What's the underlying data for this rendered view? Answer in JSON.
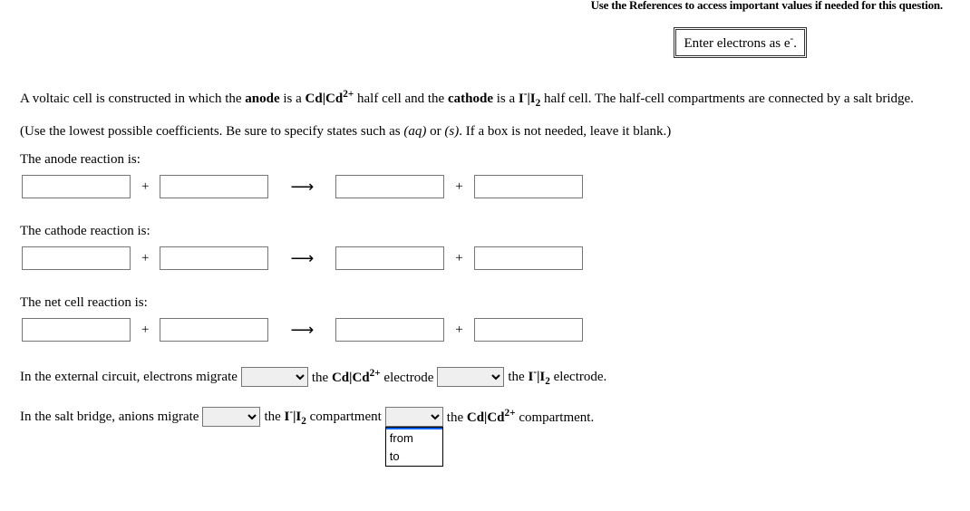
{
  "top_cutoff": "Use the References to access important values if needed for this question.",
  "hint_prefix": "Enter electrons as e",
  "hint_sup": "-",
  "hint_suffix": ".",
  "q_p1": "A voltaic cell is constructed in which the ",
  "q_b1": "anode",
  "q_p2": " is a ",
  "q_cd_a": "Cd",
  "q_cd_b": "|Cd",
  "q_cd_sup": "2+",
  "q_p3": " half cell and the ",
  "q_b2": "cathode",
  "q_p4": " is a ",
  "q_i_a": "I",
  "q_i_sup": "-",
  "q_i_b": "|I",
  "q_i_sub": "2",
  "q_p5": " half cell. The half-cell compartments are connected by a salt bridge.",
  "instr_a": "(Use the lowest possible coefficients. Be sure to specify states such as ",
  "instr_i1": "(aq)",
  "instr_b": " or ",
  "instr_i2": "(s)",
  "instr_c": ". If a box is not needed, leave it blank.)",
  "sec_anode": "The anode reaction is:",
  "sec_cathode": "The cathode reaction is:",
  "sec_net": "The net cell reaction is:",
  "plus": "+",
  "arrow": "⟶",
  "mig1_a": "In the external circuit, electrons migrate ",
  "mig1_b_pre": " the ",
  "mig1_b_cd": "Cd|Cd",
  "mig1_b_sup": "2+",
  "mig1_b_post": " electrode ",
  "mig1_c_pre": " the ",
  "mig1_c_i": "I",
  "mig1_c_sup1": "-",
  "mig1_c_i2": "|I",
  "mig1_c_sub": "2",
  "mig1_c_post": " electrode.",
  "mig2_a": "In the salt bridge, anions migrate ",
  "mig2_b_pre": " the ",
  "mig2_b_i": "I",
  "mig2_b_sup1": "-",
  "mig2_b_i2": "|I",
  "mig2_b_sub": "2",
  "mig2_b_post": " compartment ",
  "mig2_c_pre": " the ",
  "mig2_c_cd": "Cd|Cd",
  "mig2_c_sup": "2+",
  "mig2_c_post": " compartment.",
  "dd_blank": " ",
  "dd_from": "from",
  "dd_to": "to"
}
